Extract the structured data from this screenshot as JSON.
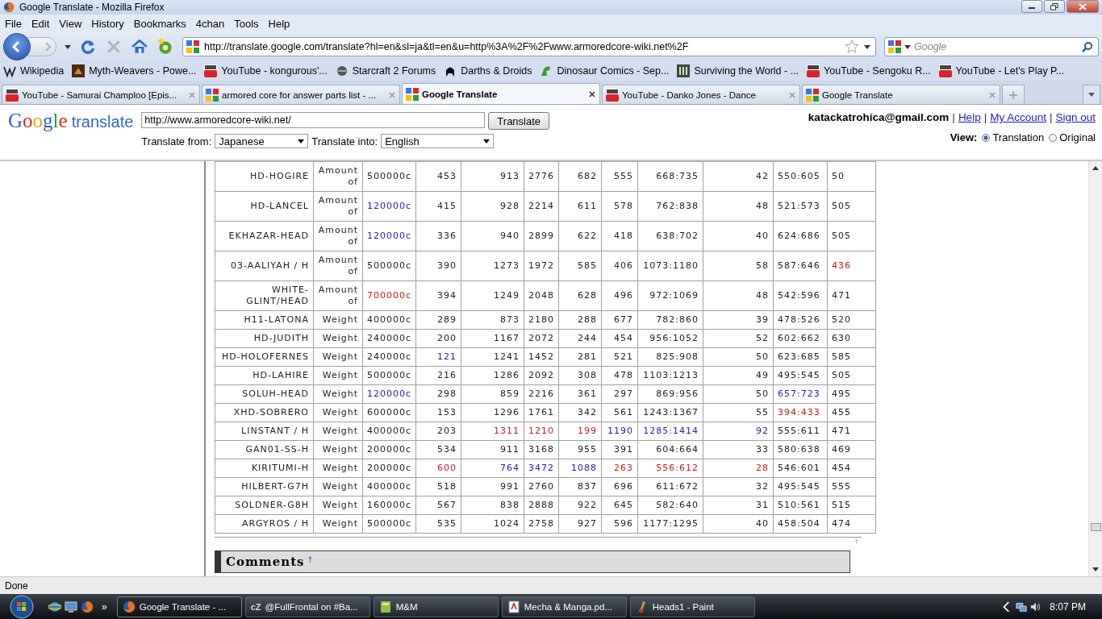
{
  "window": {
    "title": "Google Translate - Mozilla Firefox"
  },
  "menu": [
    "File",
    "Edit",
    "View",
    "History",
    "Bookmarks",
    "4chan",
    "Tools",
    "Help"
  ],
  "address_bar": {
    "value": "http://translate.google.com/translate?hl=en&sl=ja&tl=en&u=http%3A%2F%2Fwww.armoredcore-wiki.net%2F"
  },
  "search": {
    "placeholder": "Google"
  },
  "bookmarks": [
    {
      "label": "Wikipedia",
      "kind": "wiki"
    },
    {
      "label": "Myth-Weavers - Powe...",
      "kind": "dragon"
    },
    {
      "label": "YouTube - kongurous'...",
      "kind": "youtube"
    },
    {
      "label": "Starcraft 2 Forums",
      "kind": "orb"
    },
    {
      "label": "Darths & Droids",
      "kind": "helmet"
    },
    {
      "label": "Dinosaur Comics - Sep...",
      "kind": "dino"
    },
    {
      "label": "Surviving the World - ...",
      "kind": "stw"
    },
    {
      "label": "YouTube - Sengoku R...",
      "kind": "youtube"
    },
    {
      "label": "YouTube - Let's Play P...",
      "kind": "youtube"
    }
  ],
  "tabs": [
    {
      "label": "YouTube - Samurai Champloo [Epis...",
      "kind": "youtube",
      "selected": false
    },
    {
      "label": "armored core for answer parts list - ...",
      "kind": "google",
      "selected": false
    },
    {
      "label": "Google Translate",
      "kind": "google",
      "selected": true
    },
    {
      "label": "YouTube - Danko Jones - Dance",
      "kind": "youtube",
      "selected": false
    },
    {
      "label": "Google Translate",
      "kind": "google",
      "selected": false
    }
  ],
  "translate_bar": {
    "logo": "Google",
    "product": "translate",
    "url": "http://www.armoredcore-wiki.net/",
    "button": "Translate",
    "from_label": "Translate from:",
    "from": "Japanese",
    "into_label": "Translate into:",
    "into": "English",
    "account": "katackatrohica@gmail.com",
    "links": [
      {
        "text": "|",
        "kind": "separator"
      },
      {
        "text": "Help",
        "kind": "link"
      },
      {
        "text": "|",
        "kind": "separator"
      },
      {
        "text": "My Account",
        "kind": "link"
      },
      {
        "text": "|",
        "kind": "separator"
      },
      {
        "text": "Sign out",
        "kind": "link"
      }
    ],
    "view_label": "View:",
    "views": [
      {
        "label": "Translation",
        "selected": true
      },
      {
        "label": "Original",
        "selected": false
      }
    ]
  },
  "table": {
    "rows": [
      [
        "HD-HOGIRE",
        "Amount of",
        "500000c",
        "453",
        "913",
        "2776",
        "682",
        "555",
        "668:735",
        "42",
        "550:605",
        "50"
      ],
      [
        "HD-LANCEL",
        "Amount of",
        {
          "text": "120000c",
          "color": "#1a1acc"
        },
        "415",
        "928",
        "2214",
        "611",
        "578",
        "762:838",
        "48",
        "521:573",
        "505"
      ],
      [
        "EKHAZAR-HEAD",
        "Amount of",
        {
          "text": "120000c",
          "color": "#1a1acc"
        },
        "336",
        "940",
        "2899",
        "622",
        "418",
        "638:702",
        "40",
        "624:686",
        "505"
      ],
      [
        "03-AALIYAH / H",
        "Amount of",
        "500000c",
        "390",
        "1273",
        "1972",
        "585",
        "406",
        "1073:1180",
        "58",
        "587:646",
        {
          "text": "436",
          "color": "#cc1a1a"
        }
      ],
      [
        "WHITE-GLINT/HEAD",
        "Amount of",
        {
          "text": "700000c",
          "color": "#cc1a1a"
        },
        "394",
        "1249",
        "2048",
        "628",
        "496",
        "972:1069",
        "48",
        "542:596",
        "471"
      ],
      [
        "H11-LATONA",
        "Weight",
        "400000c",
        "289",
        "873",
        "2180",
        "288",
        "677",
        "782:860",
        "39",
        "478:526",
        "520"
      ],
      [
        "HD-JUDITH",
        "Weight",
        "240000c",
        "200",
        "1167",
        "2072",
        "244",
        "454",
        "956:1052",
        "52",
        "602:662",
        "630"
      ],
      [
        "HD-HOLOFERNES",
        "Weight",
        "240000c",
        {
          "text": "121",
          "color": "#1a1acc"
        },
        "1241",
        "1452",
        "281",
        "521",
        "825:908",
        "50",
        "623:685",
        "585"
      ],
      [
        "HD-LAHIRE",
        "Weight",
        "500000c",
        "216",
        "1286",
        "2092",
        "308",
        "478",
        "1103:1213",
        "49",
        "495:545",
        "505"
      ],
      [
        "SOLUH-HEAD",
        "Weight",
        {
          "text": "120000c",
          "color": "#1a1acc"
        },
        "298",
        "859",
        "2216",
        "361",
        "297",
        "869:956",
        "50",
        {
          "text": "657:723",
          "color": "#1a1acc"
        },
        "495"
      ],
      [
        "XHD-SOBRERO",
        "Weight",
        "600000c",
        "153",
        "1296",
        "1761",
        "342",
        "561",
        "1243:1367",
        "55",
        {
          "text": "394:433",
          "color": "#cc1a1a"
        },
        "455"
      ],
      [
        "LINSTANT / H",
        "Weight",
        "400000c",
        "203",
        {
          "text": "1311",
          "color": "#cc1a1a"
        },
        {
          "text": "1210",
          "color": "#cc1a1a"
        },
        {
          "text": "199",
          "color": "#cc1a1a"
        },
        {
          "text": "1190",
          "color": "#1a1acc"
        },
        {
          "text": "1285:1414",
          "color": "#1a1acc"
        },
        {
          "text": "92",
          "color": "#1a1acc"
        },
        "555:611",
        "471"
      ],
      [
        "GAN01-SS-H",
        "Weight",
        "200000c",
        "534",
        "911",
        "3168",
        "955",
        "391",
        "604:664",
        "33",
        "580:638",
        "469"
      ],
      [
        "KIRITUMI-H",
        "Weight",
        "200000c",
        {
          "text": "600",
          "color": "#cc1a1a"
        },
        {
          "text": "764",
          "color": "#1a1acc"
        },
        {
          "text": "3472",
          "color": "#1a1acc"
        },
        {
          "text": "1088",
          "color": "#1a1acc"
        },
        {
          "text": "263",
          "color": "#cc1a1a"
        },
        {
          "text": "556:612",
          "color": "#cc1a1a"
        },
        {
          "text": "28",
          "color": "#cc1a1a"
        },
        "546:601",
        "454"
      ],
      [
        "HILBERT-G7H",
        "Weight",
        "400000c",
        "518",
        "991",
        "2760",
        "837",
        "696",
        "611:672",
        "32",
        "495:545",
        "555"
      ],
      [
        "SOLDNER-G8H",
        "Weight",
        "160000c",
        "567",
        "838",
        "2888",
        "922",
        "645",
        "582:640",
        "31",
        "510:561",
        "515"
      ],
      [
        "ARGYROS / H",
        "Weight",
        "500000c",
        "535",
        "1024",
        "2758",
        "927",
        "596",
        "1177:1295",
        "40",
        "458:504",
        "474"
      ]
    ]
  },
  "comments": {
    "top_mark": "†",
    "title": "Comments",
    "mark": "†"
  },
  "status_bar": "Done",
  "taskbar": {
    "overflow": "»",
    "tasks": [
      {
        "label": "Google Translate - ...",
        "kind": "firefox",
        "selected": true
      },
      {
        "label": "@FullFrontal on #Ba...",
        "kind": "chat",
        "badge": "cZ",
        "selected": false
      },
      {
        "label": "M&M",
        "kind": "folder",
        "selected": false
      },
      {
        "label": "Mecha & Manga.pd...",
        "kind": "pdf",
        "selected": false
      },
      {
        "label": "Heads1 - Paint",
        "kind": "paint",
        "selected": false
      }
    ],
    "time": "8:07 PM"
  }
}
